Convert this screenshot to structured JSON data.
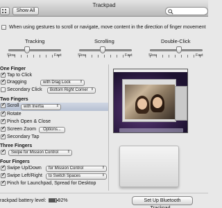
{
  "window": {
    "title": "Trackpad"
  },
  "toolbar": {
    "show_all_label": "Show All"
  },
  "scroll_direction": {
    "label": "When using gestures to scroll or navigate, move content in the direction of finger movement",
    "checked": false
  },
  "sliders": [
    {
      "title": "Tracking",
      "slow": "Slow",
      "fast": "Fast",
      "level": 0.35
    },
    {
      "title": "Scrolling",
      "slow": "Slow",
      "fast": "Fast",
      "level": 0.45
    },
    {
      "title": "Double-Click",
      "slow": "Slow",
      "fast": "Fast",
      "level": 0.55
    }
  ],
  "one_finger": {
    "header": "One Finger",
    "tap_to_click": "Tap to Click",
    "dragging": "Dragging",
    "dragging_option": "with Drag Lock",
    "secondary_click": "Secondary Click",
    "secondary_click_option": "Bottom Right Corner"
  },
  "two_fingers": {
    "header": "Two Fingers",
    "scroll": "Scroll",
    "scroll_option": "with Inertia",
    "rotate": "Rotate",
    "pinch": "Pinch Open & Close",
    "screen_zoom": "Screen Zoom",
    "options_button": "Options...",
    "secondary_tap": "Secondary Tap"
  },
  "three_fingers": {
    "header": "Three Fingers",
    "swipe_option": "Swipe for Mission Control"
  },
  "four_fingers": {
    "header": "Four Fingers",
    "swipe_up_down": "Swipe Up/Down",
    "swipe_up_down_option": "for Mission Control",
    "swipe_left_right": "Swipe Left/Right",
    "swipe_left_right_option": "to Switch Spaces",
    "pinch": "Pinch for Launchpad, Spread for Desktop"
  },
  "footer": {
    "battery_label": "rackpad battery level:",
    "battery_value": "92%",
    "setup_button": "Set Up Bluetooth Trackpad..."
  }
}
